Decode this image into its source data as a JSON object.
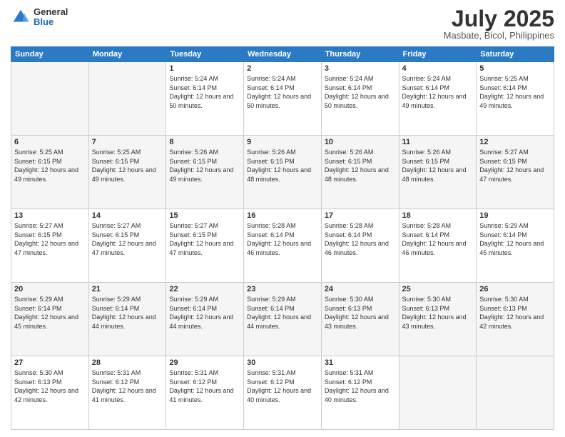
{
  "header": {
    "logo": {
      "general": "General",
      "blue": "Blue"
    },
    "title": "July 2025",
    "location": "Masbate, Bicol, Philippines"
  },
  "calendar": {
    "weekdays": [
      "Sunday",
      "Monday",
      "Tuesday",
      "Wednesday",
      "Thursday",
      "Friday",
      "Saturday"
    ],
    "weeks": [
      [
        {
          "day": "",
          "sunrise": "",
          "sunset": "",
          "daylight": ""
        },
        {
          "day": "",
          "sunrise": "",
          "sunset": "",
          "daylight": ""
        },
        {
          "day": "1",
          "sunrise": "Sunrise: 5:24 AM",
          "sunset": "Sunset: 6:14 PM",
          "daylight": "Daylight: 12 hours and 50 minutes."
        },
        {
          "day": "2",
          "sunrise": "Sunrise: 5:24 AM",
          "sunset": "Sunset: 6:14 PM",
          "daylight": "Daylight: 12 hours and 50 minutes."
        },
        {
          "day": "3",
          "sunrise": "Sunrise: 5:24 AM",
          "sunset": "Sunset: 6:14 PM",
          "daylight": "Daylight: 12 hours and 50 minutes."
        },
        {
          "day": "4",
          "sunrise": "Sunrise: 5:24 AM",
          "sunset": "Sunset: 6:14 PM",
          "daylight": "Daylight: 12 hours and 49 minutes."
        },
        {
          "day": "5",
          "sunrise": "Sunrise: 5:25 AM",
          "sunset": "Sunset: 6:14 PM",
          "daylight": "Daylight: 12 hours and 49 minutes."
        }
      ],
      [
        {
          "day": "6",
          "sunrise": "Sunrise: 5:25 AM",
          "sunset": "Sunset: 6:15 PM",
          "daylight": "Daylight: 12 hours and 49 minutes."
        },
        {
          "day": "7",
          "sunrise": "Sunrise: 5:25 AM",
          "sunset": "Sunset: 6:15 PM",
          "daylight": "Daylight: 12 hours and 49 minutes."
        },
        {
          "day": "8",
          "sunrise": "Sunrise: 5:26 AM",
          "sunset": "Sunset: 6:15 PM",
          "daylight": "Daylight: 12 hours and 49 minutes."
        },
        {
          "day": "9",
          "sunrise": "Sunrise: 5:26 AM",
          "sunset": "Sunset: 6:15 PM",
          "daylight": "Daylight: 12 hours and 48 minutes."
        },
        {
          "day": "10",
          "sunrise": "Sunrise: 5:26 AM",
          "sunset": "Sunset: 6:15 PM",
          "daylight": "Daylight: 12 hours and 48 minutes."
        },
        {
          "day": "11",
          "sunrise": "Sunrise: 5:26 AM",
          "sunset": "Sunset: 6:15 PM",
          "daylight": "Daylight: 12 hours and 48 minutes."
        },
        {
          "day": "12",
          "sunrise": "Sunrise: 5:27 AM",
          "sunset": "Sunset: 6:15 PM",
          "daylight": "Daylight: 12 hours and 47 minutes."
        }
      ],
      [
        {
          "day": "13",
          "sunrise": "Sunrise: 5:27 AM",
          "sunset": "Sunset: 6:15 PM",
          "daylight": "Daylight: 12 hours and 47 minutes."
        },
        {
          "day": "14",
          "sunrise": "Sunrise: 5:27 AM",
          "sunset": "Sunset: 6:15 PM",
          "daylight": "Daylight: 12 hours and 47 minutes."
        },
        {
          "day": "15",
          "sunrise": "Sunrise: 5:27 AM",
          "sunset": "Sunset: 6:15 PM",
          "daylight": "Daylight: 12 hours and 47 minutes."
        },
        {
          "day": "16",
          "sunrise": "Sunrise: 5:28 AM",
          "sunset": "Sunset: 6:14 PM",
          "daylight": "Daylight: 12 hours and 46 minutes."
        },
        {
          "day": "17",
          "sunrise": "Sunrise: 5:28 AM",
          "sunset": "Sunset: 6:14 PM",
          "daylight": "Daylight: 12 hours and 46 minutes."
        },
        {
          "day": "18",
          "sunrise": "Sunrise: 5:28 AM",
          "sunset": "Sunset: 6:14 PM",
          "daylight": "Daylight: 12 hours and 46 minutes."
        },
        {
          "day": "19",
          "sunrise": "Sunrise: 5:29 AM",
          "sunset": "Sunset: 6:14 PM",
          "daylight": "Daylight: 12 hours and 45 minutes."
        }
      ],
      [
        {
          "day": "20",
          "sunrise": "Sunrise: 5:29 AM",
          "sunset": "Sunset: 6:14 PM",
          "daylight": "Daylight: 12 hours and 45 minutes."
        },
        {
          "day": "21",
          "sunrise": "Sunrise: 5:29 AM",
          "sunset": "Sunset: 6:14 PM",
          "daylight": "Daylight: 12 hours and 44 minutes."
        },
        {
          "day": "22",
          "sunrise": "Sunrise: 5:29 AM",
          "sunset": "Sunset: 6:14 PM",
          "daylight": "Daylight: 12 hours and 44 minutes."
        },
        {
          "day": "23",
          "sunrise": "Sunrise: 5:29 AM",
          "sunset": "Sunset: 6:14 PM",
          "daylight": "Daylight: 12 hours and 44 minutes."
        },
        {
          "day": "24",
          "sunrise": "Sunrise: 5:30 AM",
          "sunset": "Sunset: 6:13 PM",
          "daylight": "Daylight: 12 hours and 43 minutes."
        },
        {
          "day": "25",
          "sunrise": "Sunrise: 5:30 AM",
          "sunset": "Sunset: 6:13 PM",
          "daylight": "Daylight: 12 hours and 43 minutes."
        },
        {
          "day": "26",
          "sunrise": "Sunrise: 5:30 AM",
          "sunset": "Sunset: 6:13 PM",
          "daylight": "Daylight: 12 hours and 42 minutes."
        }
      ],
      [
        {
          "day": "27",
          "sunrise": "Sunrise: 5:30 AM",
          "sunset": "Sunset: 6:13 PM",
          "daylight": "Daylight: 12 hours and 42 minutes."
        },
        {
          "day": "28",
          "sunrise": "Sunrise: 5:31 AM",
          "sunset": "Sunset: 6:12 PM",
          "daylight": "Daylight: 12 hours and 41 minutes."
        },
        {
          "day": "29",
          "sunrise": "Sunrise: 5:31 AM",
          "sunset": "Sunset: 6:12 PM",
          "daylight": "Daylight: 12 hours and 41 minutes."
        },
        {
          "day": "30",
          "sunrise": "Sunrise: 5:31 AM",
          "sunset": "Sunset: 6:12 PM",
          "daylight": "Daylight: 12 hours and 40 minutes."
        },
        {
          "day": "31",
          "sunrise": "Sunrise: 5:31 AM",
          "sunset": "Sunset: 6:12 PM",
          "daylight": "Daylight: 12 hours and 40 minutes."
        },
        {
          "day": "",
          "sunrise": "",
          "sunset": "",
          "daylight": ""
        },
        {
          "day": "",
          "sunrise": "",
          "sunset": "",
          "daylight": ""
        }
      ]
    ]
  }
}
